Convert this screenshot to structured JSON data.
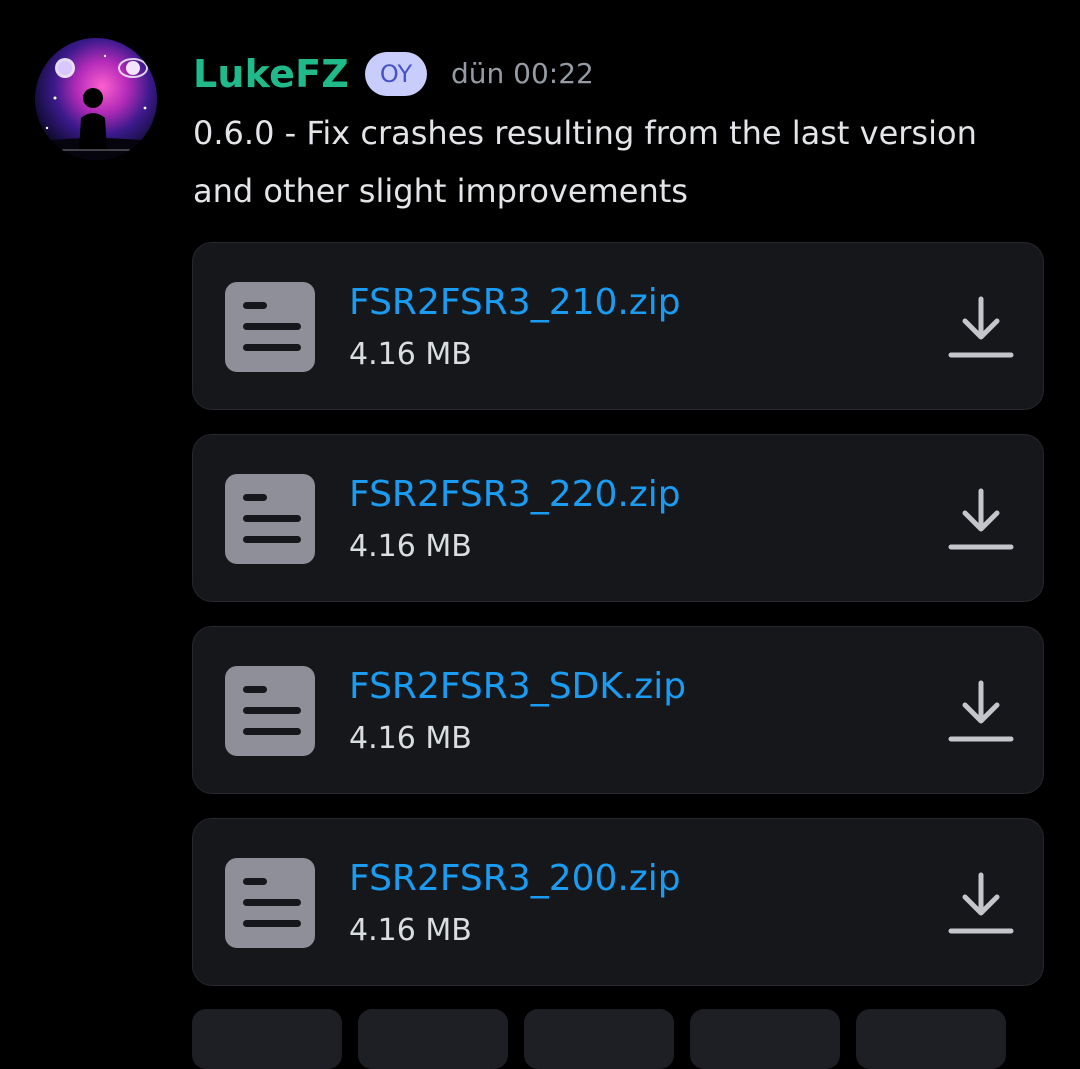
{
  "message": {
    "username": "LukeFZ",
    "badge": "OY",
    "timestamp": "dün 00:22",
    "text": "0.6.0 - Fix crashes resulting from the last version and other slight improvements"
  },
  "attachments": [
    {
      "name": "FSR2FSR3_210.zip",
      "size": "4.16 MB"
    },
    {
      "name": "FSR2FSR3_220.zip",
      "size": "4.16 MB"
    },
    {
      "name": "FSR2FSR3_SDK.zip",
      "size": "4.16 MB"
    },
    {
      "name": "FSR2FSR3_200.zip",
      "size": "4.16 MB"
    }
  ],
  "icons": {
    "file": "file-document-icon",
    "download": "download-icon"
  },
  "colors": {
    "background": "#000000",
    "username": "#1fb98a",
    "badge_bg": "#c9cdfb",
    "badge_text": "#4752c4",
    "link": "#1a9cf2",
    "card_bg": "#16171b",
    "icon_gray": "#8e8f98"
  }
}
